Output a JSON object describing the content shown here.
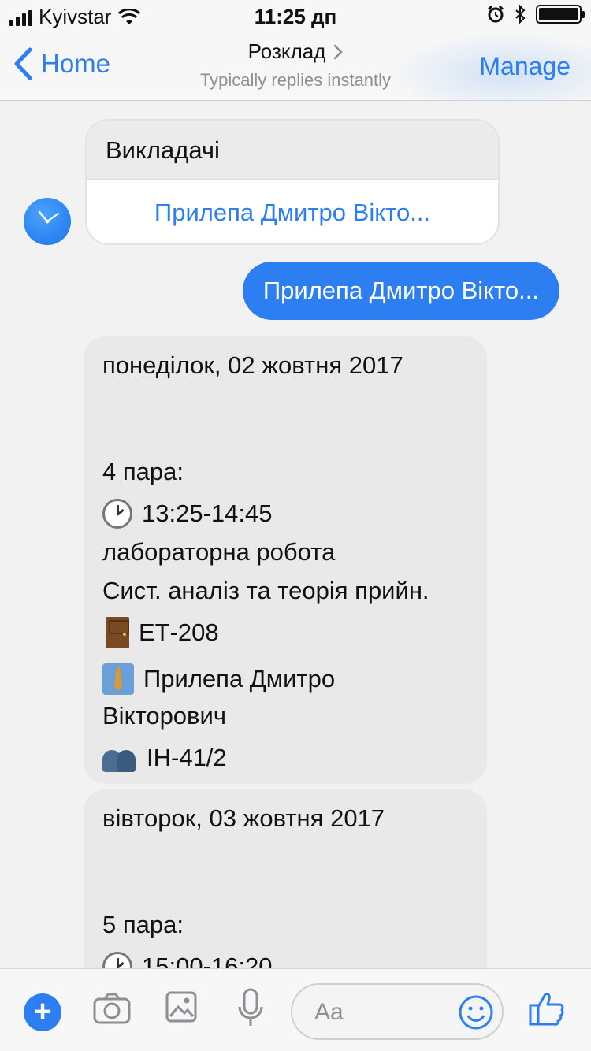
{
  "status_bar": {
    "carrier": "Kyivstar",
    "time": "11:25 дп"
  },
  "nav": {
    "back_label": "Home",
    "title": "Розклад",
    "subtitle": "Typically replies instantly",
    "manage_label": "Manage"
  },
  "card": {
    "header": "Викладачі",
    "button_label": "Прилепа Дмитро Вікто..."
  },
  "outgoing_message": "Прилепа Дмитро Вікто...",
  "messages": [
    {
      "date": "понеділок, 02 жовтня 2017",
      "pair": "4 пара:",
      "time": "13:25-14:45",
      "type": "лабораторна робота",
      "subject": "Сист. аналіз та теорія прийн.",
      "room": "ЕТ-208",
      "teacher_line1": "Прилепа Дмитро",
      "teacher_line2": "Вікторович",
      "group": "ІН-41/2"
    },
    {
      "date": "вівторок, 03 жовтня 2017",
      "pair": "5 пара:",
      "time": "15:00-16:20"
    }
  ],
  "composer": {
    "placeholder": "Aa",
    "icons": [
      "plus-icon",
      "camera-icon",
      "image-icon",
      "microphone-icon",
      "emoji-icon",
      "thumbs-up-icon"
    ]
  },
  "colors": {
    "accent": "#2d7ef0",
    "bubble_gray": "#e9e9e9",
    "background": "#f2f2f2"
  }
}
